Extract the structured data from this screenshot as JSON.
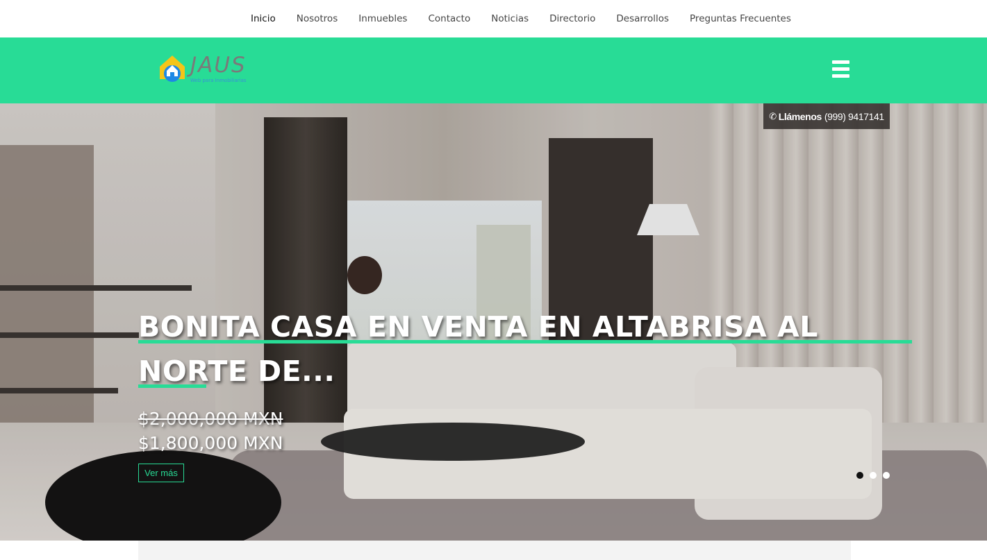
{
  "nav": {
    "items": [
      {
        "label": "Inicio",
        "active": true
      },
      {
        "label": "Nosotros",
        "active": false
      },
      {
        "label": "Inmuebles",
        "active": false
      },
      {
        "label": "Contacto",
        "active": false
      },
      {
        "label": "Noticias",
        "active": false
      },
      {
        "label": "Directorio",
        "active": false
      },
      {
        "label": "Desarrollos",
        "active": false
      },
      {
        "label": "Preguntas Frecuentes",
        "active": false
      }
    ]
  },
  "header": {
    "logo_text": "JAUS",
    "logo_tagline": "Web para Inmobiliarias",
    "menu_icon": "hamburger-menu-icon",
    "accent_color": "#28dc96"
  },
  "hero": {
    "call": {
      "icon": "phone-icon",
      "label": "Llámenos",
      "number": "(999) 9417141"
    },
    "title": "BONITA CASA EN VENTA EN ALTABRISA AL NORTE DE...",
    "price_old": "$2,000,000 MXN",
    "price_new": "$1,800,000 MXN",
    "cta": "Ver más",
    "slides_count": 3,
    "active_slide": 1
  }
}
